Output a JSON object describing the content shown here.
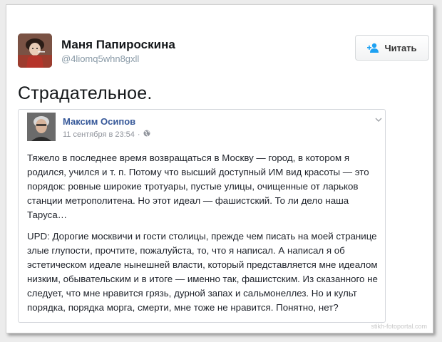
{
  "tweet": {
    "author_name": "Маня Папироскина",
    "author_handle": "@4liomq5whn8gxll",
    "follow_label": "Читать",
    "text": "Страдательное."
  },
  "embed": {
    "author_name": "Максим Осипов",
    "date": "11 сентября в 23:54",
    "separator": "·",
    "paragraph_1": "Тяжело в последнее время возвращаться в Москву — город, в котором я родился, учился и т. п. Потому что высший доступный ИМ вид красоты — это порядок: ровные широкие тротуары, пустые улицы, очищенные от ларьков станции метрополитена. Но этот идеал — фашистский. То ли дело наша Таруса…",
    "paragraph_2": "UPD: Дорогие москвичи и гости столицы, прежде чем писать на моей странице злые глупости, прочтите, пожалуйста, то, что я написал. А написал я об эстетическом идеале нынешней власти, который представляется мне идеалом низким, обывательским и в итоге — именно так, фашистским. Из сказанного не следует, что мне нравится грязь, дурной запах и сальмонеллез. Но и культ порядка, порядка морга, смерти, мне тоже не нравится. Понятно, нет?"
  },
  "watermark": "stikh-fotoportal.com",
  "colors": {
    "fb_link": "#365899",
    "twitter_text": "#14171a",
    "twitter_secondary": "#8899a6",
    "follow_icon": "#1da1f2"
  },
  "icons": [
    "add-user-icon",
    "globe-icon",
    "chevron-down-icon"
  ]
}
